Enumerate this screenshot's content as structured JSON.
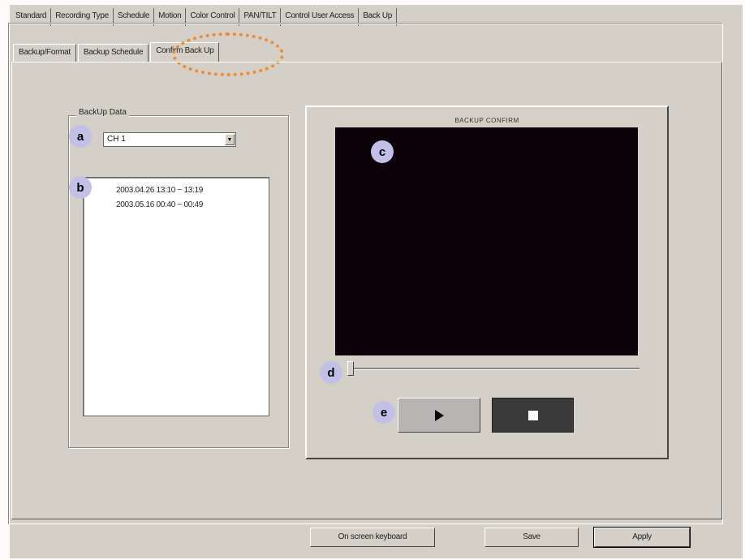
{
  "top_tabs": [
    "Standard",
    "Recording Type",
    "Schedule",
    "Motion",
    "Color Control",
    "PAN/TILT",
    "Control User Access",
    "Back Up"
  ],
  "sub_tabs": [
    "Backup/Format",
    "Backup Schedule",
    "Confirm Back Up"
  ],
  "backup_group": {
    "title": "BackUp Data",
    "channel_select": "CH 1",
    "entries": [
      "2003.04.26 13:10 ~ 13:19",
      "2003.05.16 00:40 ~ 00:49"
    ]
  },
  "video_panel": {
    "title": "BACKUP CONFIRM"
  },
  "markers": {
    "a": "a",
    "b": "b",
    "c": "c",
    "d": "d",
    "e": "e"
  },
  "buttons": {
    "keyboard": "On screen keyboard",
    "save": "Save",
    "apply": "Apply"
  },
  "colors": {
    "highlight": "#f08a30",
    "marker": "#c3c0e8",
    "video_bg": "#0c0109"
  },
  "icons": {
    "play": "play-icon",
    "stop": "stop-icon"
  }
}
